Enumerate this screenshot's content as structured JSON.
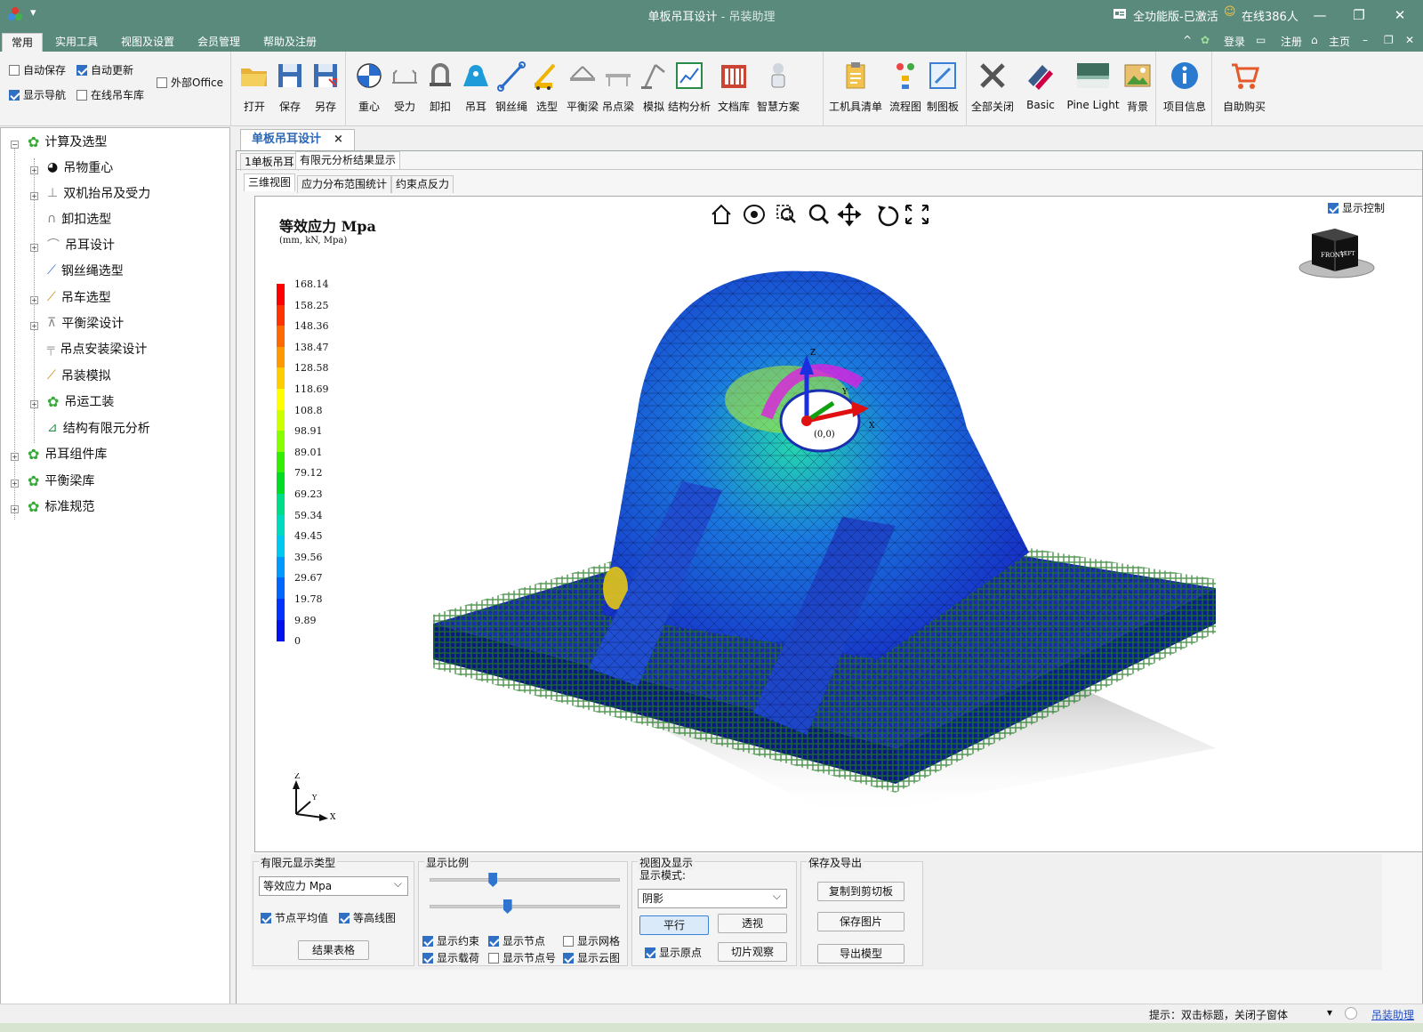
{
  "window": {
    "title": "单板吊耳设计",
    "title_sep": " - ",
    "app_name": "吊装助理",
    "edition": "全功能版-已激活",
    "online": "在线386人"
  },
  "menu": {
    "tabs": [
      "常用",
      "实用工具",
      "视图及设置",
      "会员管理",
      "帮助及注册"
    ],
    "login": "登录",
    "register": "注册",
    "home": "主页"
  },
  "ribbon": {
    "options": [
      {
        "label": "自动保存",
        "checked": false
      },
      {
        "label": "自动更新",
        "checked": true
      },
      {
        "label": "外部Office",
        "checked": false
      },
      {
        "label": "显示导航",
        "checked": true
      },
      {
        "label": "在线吊车库",
        "checked": false
      }
    ],
    "file_buttons": [
      "打开",
      "保存",
      "另存"
    ],
    "tool_buttons": [
      "重心",
      "受力",
      "卸扣",
      "吊耳",
      "钢丝绳",
      "选型",
      "平衡梁",
      "吊点梁",
      "模拟",
      "结构分析",
      "文档库",
      "智慧方案"
    ],
    "doc_buttons": [
      "工机具清单",
      "流程图",
      "制图板"
    ],
    "view_buttons": [
      "全部关闭",
      "Basic",
      "Pine Light",
      "背景"
    ],
    "info_buttons": [
      "项目信息"
    ],
    "buy_buttons": [
      "自助购买"
    ]
  },
  "sidebar": {
    "root1": "计算及选型",
    "items": [
      "吊物重心",
      "双机抬吊及受力",
      "卸扣选型",
      "吊耳设计",
      "钢丝绳选型",
      "吊车选型",
      "平衡梁设计",
      "吊点安装梁设计",
      "吊装模拟",
      "吊运工装",
      "结构有限元分析"
    ],
    "roots": [
      "吊耳组件库",
      "平衡梁库",
      "标准规范"
    ]
  },
  "doc_tab": {
    "label": "单板吊耳设计",
    "close": "×"
  },
  "tabs_level1": [
    "1单板吊耳",
    "有限元分析结果显示"
  ],
  "tabs_level2": [
    "三维视图",
    "应力分布范围统计",
    "约束点反力"
  ],
  "viewport": {
    "title": "等效应力 Mpa",
    "units": "(mm, kN, Mpa)",
    "show_control": "显示控制",
    "origin_label": "(0,0)",
    "cube_face": "FRONT",
    "cube_side": "LEFT",
    "axis_labels": {
      "x": "X",
      "y": "Y",
      "z": "Z"
    },
    "legend_values": [
      "168.14",
      "158.25",
      "148.36",
      "138.47",
      "128.58",
      "118.69",
      "108.8",
      "98.91",
      "89.01",
      "79.12",
      "69.23",
      "59.34",
      "49.45",
      "39.56",
      "29.67",
      "19.78",
      "9.89",
      "0"
    ],
    "legend_colors": [
      "#ff0000",
      "#ff3300",
      "#ff6a00",
      "#ff9900",
      "#ffcc00",
      "#ffff00",
      "#ccff00",
      "#88ff00",
      "#33ee00",
      "#00dd22",
      "#00dd88",
      "#00dbc0",
      "#00c8f0",
      "#0099ff",
      "#0066ff",
      "#0033ff",
      "#0011ee"
    ]
  },
  "controls": {
    "fe_type": {
      "title": "有限元显示类型",
      "selected": "等效应力 Mpa",
      "node_avg": "节点平均值",
      "contour": "等高线图",
      "result_table": "结果表格"
    },
    "scale": {
      "title": "显示比例",
      "slider1": 0.32,
      "slider2": 0.4,
      "checks": [
        {
          "label": "显示约束",
          "checked": true
        },
        {
          "label": "显示节点",
          "checked": true
        },
        {
          "label": "显示网格",
          "checked": false
        },
        {
          "label": "显示载荷",
          "checked": true
        },
        {
          "label": "显示节点号",
          "checked": false
        },
        {
          "label": "显示云图",
          "checked": true
        }
      ]
    },
    "view": {
      "title": "视图及显示",
      "mode_label": "显示模式:",
      "mode": "阴影",
      "parallel": "平行",
      "perspective": "透视",
      "show_origin": "显示原点",
      "slice": "切片观察"
    },
    "save": {
      "title": "保存及导出",
      "copy": "复制到剪切板",
      "save_image": "保存图片",
      "export_model": "导出模型"
    }
  },
  "status": {
    "hint": "提示：双击标题，关闭子窗体",
    "link": "吊装助理"
  }
}
